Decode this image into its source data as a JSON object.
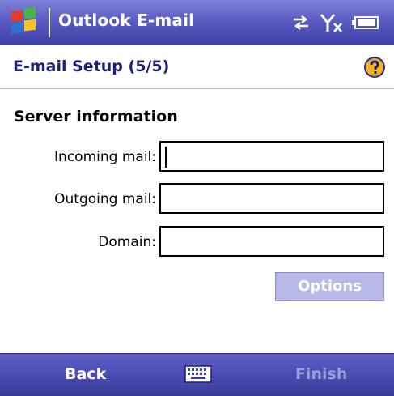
{
  "title_bar": {
    "app_title": "Outlook E-mail"
  },
  "status_icons": [
    "connectivity-icon",
    "signal-off-icon",
    "battery-icon"
  ],
  "header": {
    "title": "E-mail Setup (5/5)"
  },
  "form": {
    "section_title": "Server information",
    "incoming": {
      "label": "Incoming mail:",
      "value": ""
    },
    "outgoing": {
      "label": "Outgoing mail:",
      "value": ""
    },
    "domain": {
      "label": "Domain:",
      "value": ""
    },
    "options_label": "Options"
  },
  "menu_bar": {
    "left_label": "Back",
    "right_label": "Finish"
  },
  "colors": {
    "title_bar": "#5a5cc2",
    "header_text": "#1d1f7a",
    "disabled_button": "#b8b9e6",
    "menu_bar": "#4a4bb1",
    "disabled_softkey": "#9a9bd8"
  }
}
